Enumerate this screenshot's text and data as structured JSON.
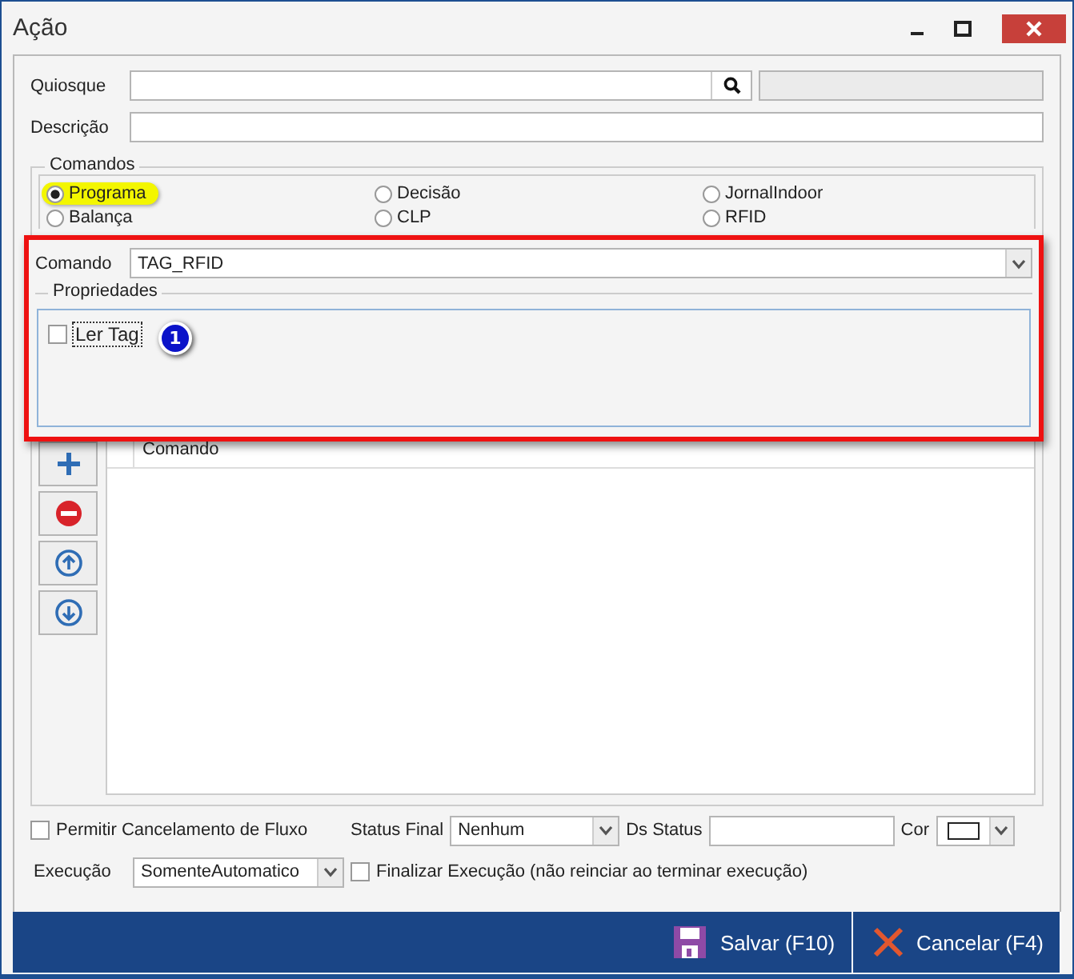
{
  "window": {
    "title": "Ação"
  },
  "quiosque": {
    "label": "Quiosque"
  },
  "descricao": {
    "label": "Descrição"
  },
  "comandos": {
    "title": "Comandos",
    "options": [
      {
        "label": "Programa",
        "selected": true,
        "highlighted": true
      },
      {
        "label": "Decisão",
        "selected": false,
        "highlighted": false
      },
      {
        "label": "JornalIndoor",
        "selected": false,
        "highlighted": false
      },
      {
        "label": "Balança",
        "selected": false,
        "highlighted": false
      },
      {
        "label": "CLP",
        "selected": false,
        "highlighted": false
      },
      {
        "label": "RFID",
        "selected": false,
        "highlighted": false
      }
    ]
  },
  "comando": {
    "label": "Comando",
    "value": "TAG_RFID"
  },
  "propriedades": {
    "title": "Propriedades",
    "items": [
      {
        "label": "Ler Tag",
        "checked": false
      }
    ],
    "badge": "1"
  },
  "table": {
    "columns": [
      "Comando"
    ]
  },
  "permitir": {
    "label": "Permitir Cancelamento de Fluxo",
    "checked": false
  },
  "status_final": {
    "label": "Status Final",
    "value": "Nenhum"
  },
  "ds_status": {
    "label": "Ds Status"
  },
  "cor": {
    "label": "Cor"
  },
  "execucao": {
    "label": "Execução",
    "value": "SomenteAutomatico"
  },
  "finalizar": {
    "label": "Finalizar Execução (não reinciar ao terminar execução)",
    "checked": false
  },
  "buttons": [
    {
      "kind": "save",
      "label": "Salvar (F10)"
    },
    {
      "kind": "cancel",
      "label": "Cancelar (F4)"
    }
  ]
}
